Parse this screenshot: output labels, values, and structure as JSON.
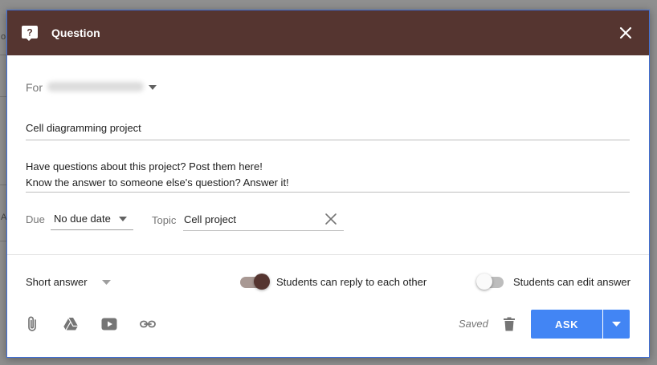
{
  "dialog": {
    "title": "Question",
    "header_color": "#553530",
    "accent_color": "#4285f4"
  },
  "form": {
    "for_label": "For",
    "title_value": "Cell diagramming project",
    "description_line1": "Have questions about this project? Post them here!",
    "description_line2": "Know the answer to someone else's question? Answer it!",
    "due_label": "Due",
    "due_value": "No due date",
    "topic_label": "Topic",
    "topic_value": "Cell project"
  },
  "options": {
    "answer_type": "Short answer",
    "reply_toggle_label": "Students can reply to each other",
    "reply_toggle_on": true,
    "edit_toggle_label": "Students can edit answer",
    "edit_toggle_on": false
  },
  "footer": {
    "attach_icons": [
      "paperclip-icon",
      "google-drive-icon",
      "youtube-icon",
      "link-icon"
    ],
    "status": "Saved",
    "ask_label": "ASK"
  }
}
